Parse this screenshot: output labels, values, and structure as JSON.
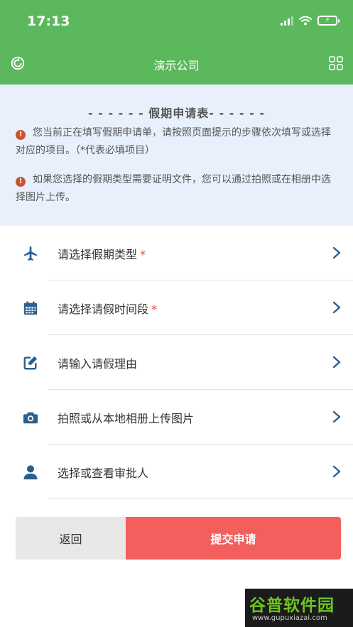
{
  "status_bar": {
    "time": "17:13"
  },
  "nav": {
    "title": "演示公司",
    "left_icon": "refresh-icon",
    "right_icon": "grid-icon"
  },
  "notice": {
    "title": "- - - - - - 假期申请表- - - - - -",
    "lines": [
      "您当前正在填写假期申请单，请按照页面提示的步骤依次填写或选择对应的项目。（*代表必填项目）",
      "如果您选择的假期类型需要证明文件，您可以通过拍照或在相册中选择图片上传。"
    ]
  },
  "rows": [
    {
      "label": "请选择假期类型",
      "required": "*",
      "icon": "airplane-icon"
    },
    {
      "label": "请选择请假时间段",
      "required": "*",
      "icon": "calendar-icon"
    },
    {
      "label": "请输入请假理由",
      "required": "",
      "icon": "edit-icon"
    },
    {
      "label": "拍照或从本地相册上传图片",
      "required": "",
      "icon": "camera-icon"
    },
    {
      "label": "选择或查看审批人",
      "required": "",
      "icon": "user-icon"
    }
  ],
  "buttons": {
    "back": "返回",
    "submit": "提交申请"
  },
  "watermark": {
    "main": "谷普软件园",
    "url": "www.gupuxiazai.com"
  },
  "colors": {
    "header": "#5cb85c",
    "notice_bg": "#e8f0fb",
    "icon": "#2c5f8f",
    "submit": "#f25f5c",
    "warn": "#c9542d"
  }
}
